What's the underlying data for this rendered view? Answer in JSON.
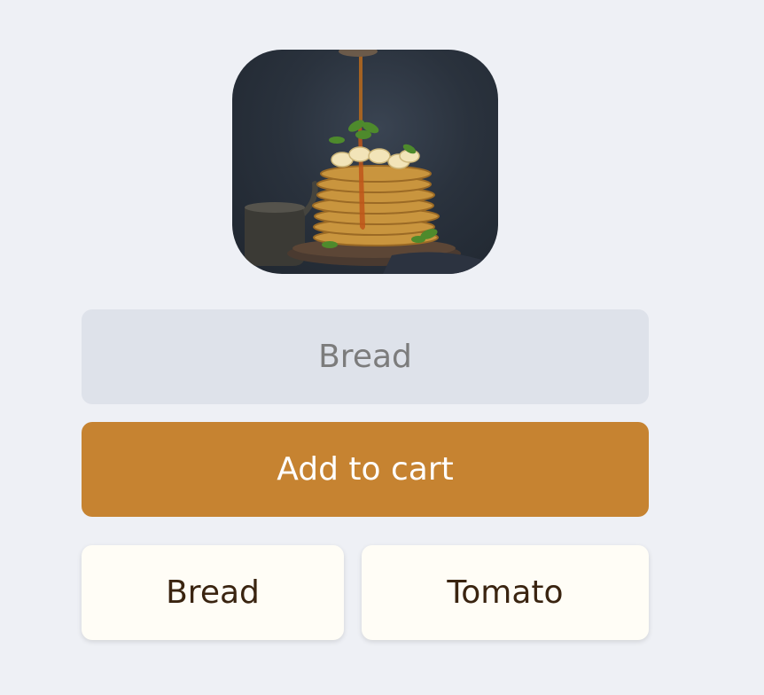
{
  "product": {
    "image_alt": "Stack of pancakes with bananas and syrup"
  },
  "name_field": {
    "value": "",
    "placeholder": "Bread"
  },
  "add_button": {
    "label": "Add to cart"
  },
  "options": [
    {
      "label": "Bread"
    },
    {
      "label": "Tomato"
    }
  ],
  "colors": {
    "background": "#eef0f5",
    "input_background": "#dee2ea",
    "accent": "#c68331",
    "option_background": "#fffdf6",
    "option_text": "#3a2410"
  }
}
